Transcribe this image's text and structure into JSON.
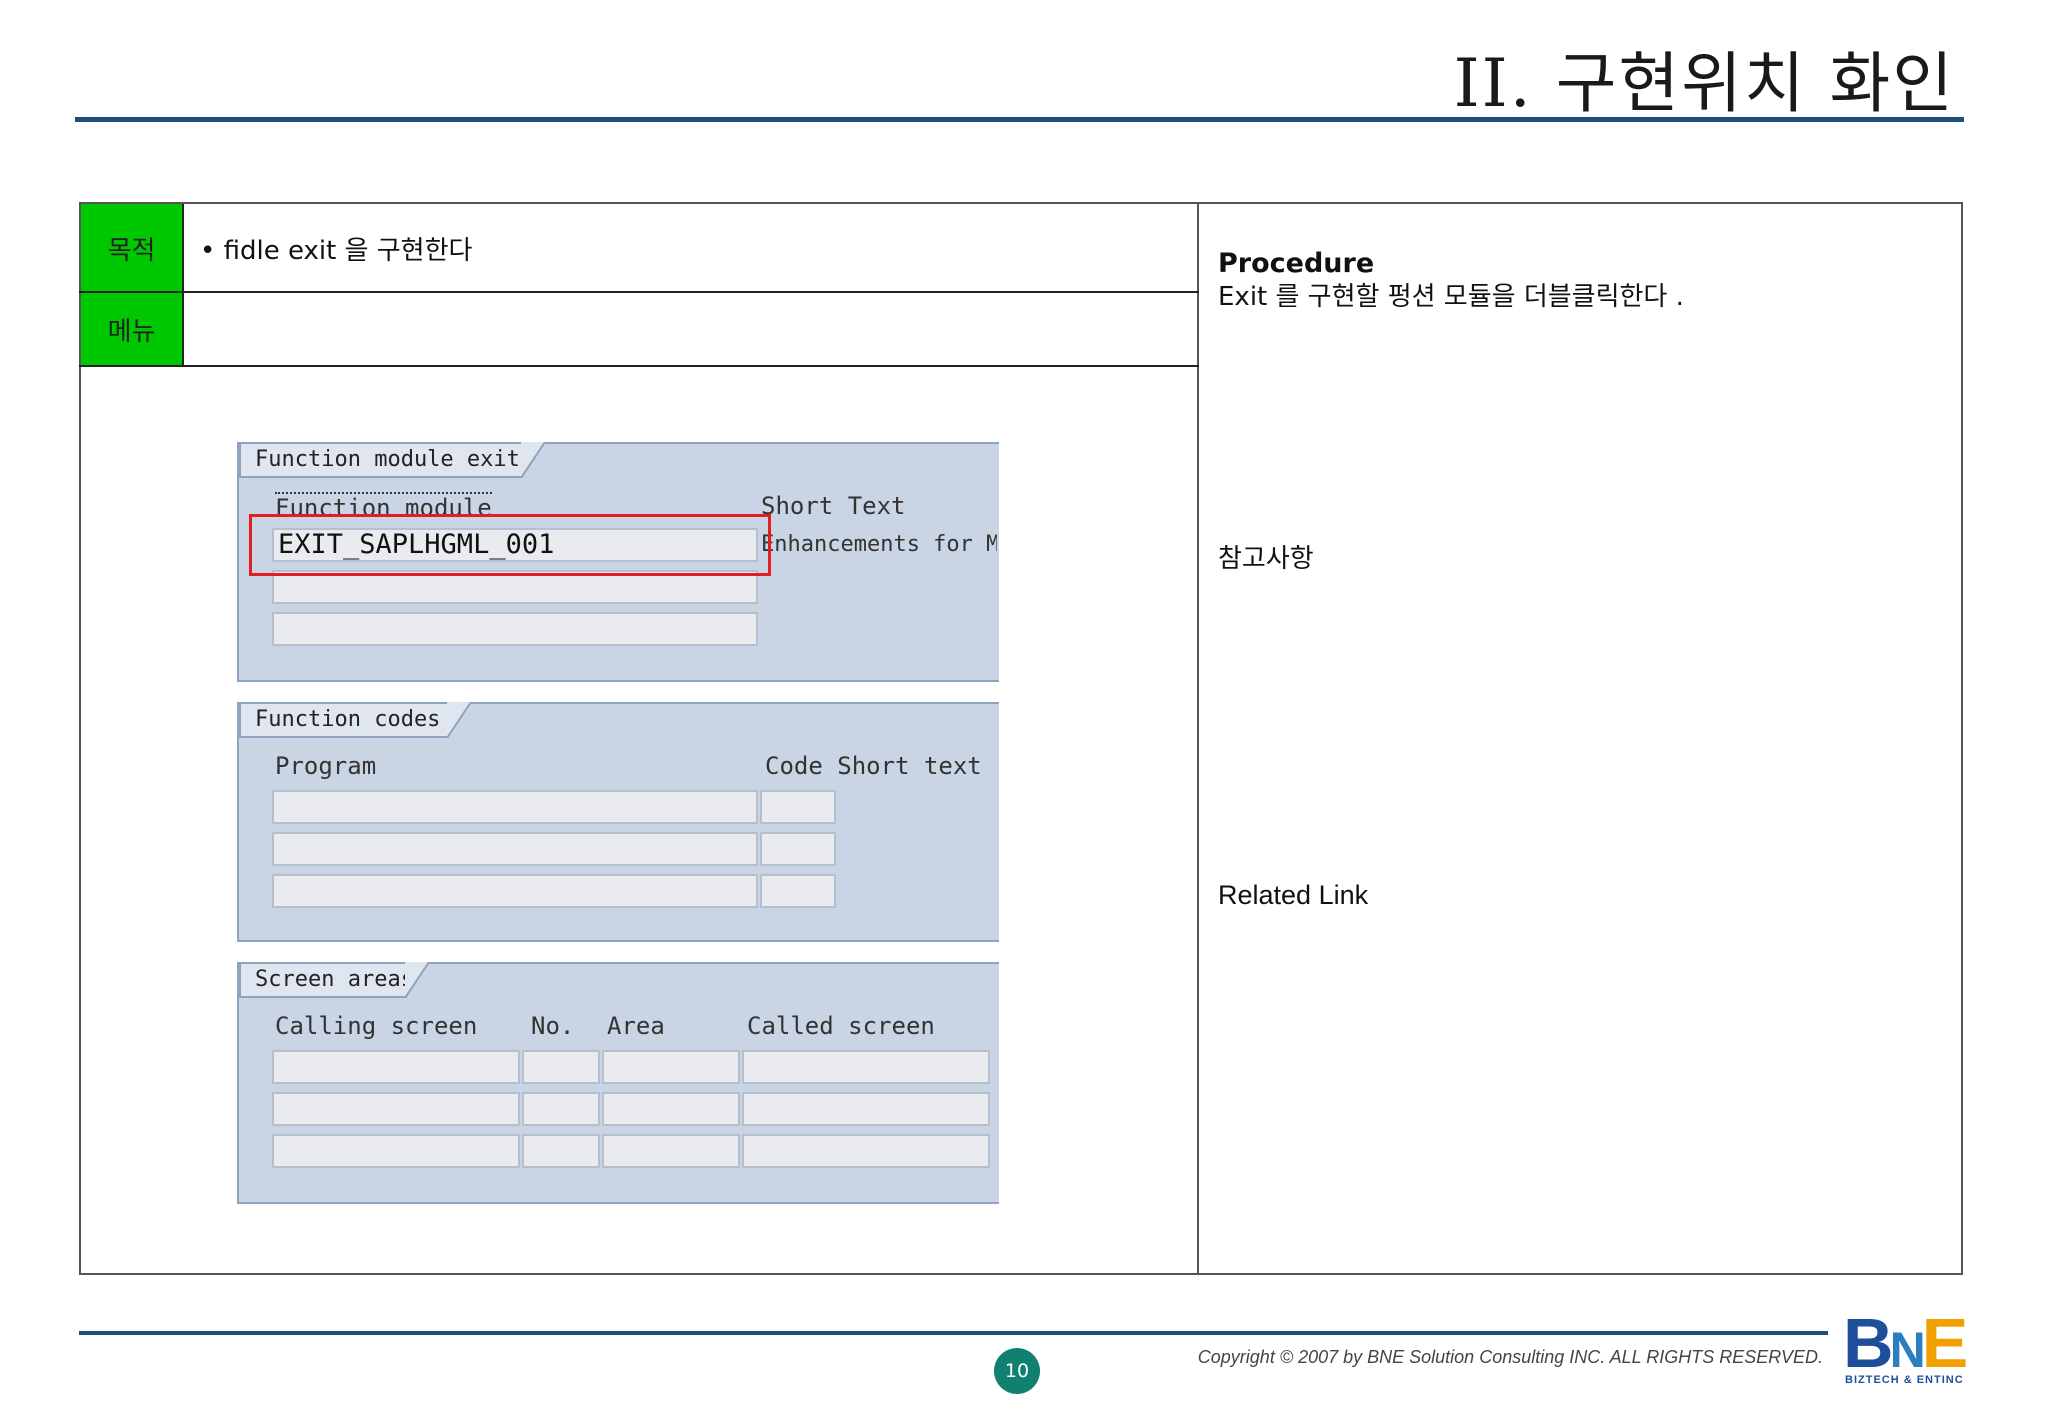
{
  "header": {
    "title": "II. 구현위치 화인"
  },
  "table": {
    "purpose_label": "목적",
    "purpose_text": "• fidle exit 을 구현한다",
    "menu_label": "메뉴",
    "menu_text": ""
  },
  "side": {
    "procedure_title": "Procedure",
    "procedure_text": "Exit 를 구현할 펑션 모듈을 더블클릭한다 .",
    "reference_title": "참고사항",
    "related_link_title": "Related Link"
  },
  "sap_screen": {
    "function_module_exits": {
      "tab_label": "Function module exits",
      "col_function_module": "Function module",
      "col_short_text": "Short Text",
      "rows": [
        {
          "function_module": "EXIT_SAPLHGML_001",
          "short_text": "Enhancements for MI"
        },
        {
          "function_module": "",
          "short_text": ""
        },
        {
          "function_module": "",
          "short_text": ""
        }
      ]
    },
    "function_codes": {
      "tab_label": "Function codes",
      "col_program": "Program",
      "col_code_short_text": "Code  Short text",
      "row_count": 3
    },
    "screen_areas": {
      "tab_label": "Screen areas",
      "col_calling_screen": "Calling screen",
      "col_no": "No.",
      "col_area": "Area",
      "col_called_screen": "Called screen",
      "row_count": 3
    }
  },
  "footer": {
    "page_number": "10",
    "copyright": "Copyright © 2007 by BNE Solution Consulting INC.   ALL RIGHTS RESERVED.",
    "logo_text": "BNE",
    "logo_sub": "BIZTECH & ENTINC"
  },
  "colors": {
    "accent_rule": "#1f4e79",
    "label_green": "#00c800",
    "highlight_red": "#e02020",
    "page_badge": "#108070"
  }
}
